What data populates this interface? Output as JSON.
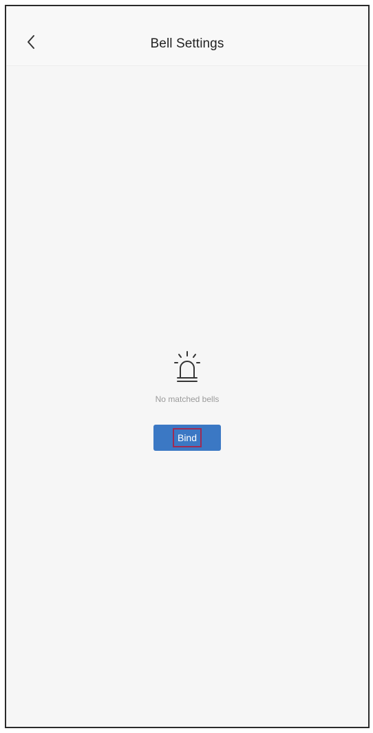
{
  "header": {
    "title": "Bell Settings",
    "back_icon": "chevron-left-icon"
  },
  "empty_state": {
    "icon": "alarm-bell-icon",
    "message": "No matched bells",
    "bind_label": "Bind"
  },
  "colors": {
    "accent": "#3b78c4",
    "highlight_box": "#a02a52",
    "background": "#f6f6f6"
  }
}
